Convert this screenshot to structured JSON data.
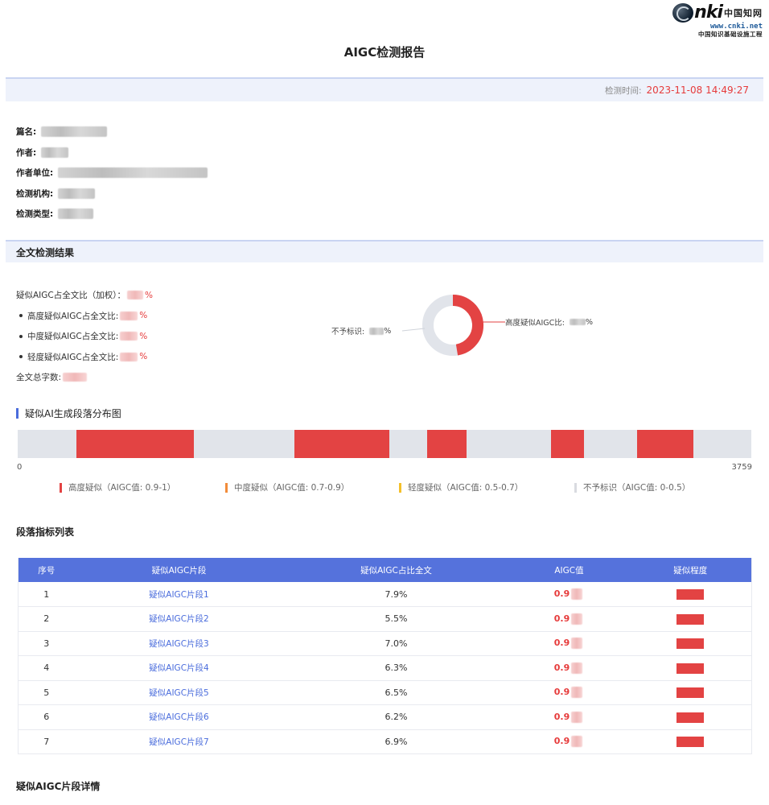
{
  "logo": {
    "mark": "nki",
    "chinese": "中国知网",
    "url": "www.cnki.net",
    "slogan": "中国知识基础设施工程"
  },
  "report": {
    "title": "AIGC检测报告",
    "time_label": "检测时间:",
    "time_value": "2023-11-08 14:49:27"
  },
  "meta": {
    "title_label": "篇名:",
    "author_label": "作者:",
    "unit_label": "作者单位:",
    "org_label": "检测机构:",
    "type_label": "检测类型:"
  },
  "full_result": {
    "section_title": "全文检测结果",
    "weighted_label": "疑似AIGC占全文比（加权）：",
    "high_label": "高度疑似AIGC占全文比:",
    "mid_label": "中度疑似AIGC占全文比:",
    "low_label": "轻度疑似AIGC占全文比:",
    "total_label": "全文总字数:",
    "pct_suffix": "%",
    "donut": {
      "high_label": "高度疑似AIGC比:",
      "none_label": "不予标识:",
      "high_color": "#e34343",
      "none_color": "#e1e4ea"
    }
  },
  "distribution": {
    "title": "疑似AI生成段落分布图",
    "axis_min": "0",
    "axis_max": "3759",
    "legend": [
      {
        "label": "高度疑似（AIGC值: 0.9-1）",
        "color": "#e34343"
      },
      {
        "label": "中度疑似（AIGC值: 0.7-0.9）",
        "color": "#f28c3a"
      },
      {
        "label": "轻度疑似（AIGC值: 0.5-0.7）",
        "color": "#f4c02a"
      },
      {
        "label": "不予标识（AIGC值: 0-0.5）",
        "color": "#d9dbe0"
      }
    ]
  },
  "paragraph_list": {
    "title": "段落指标列表",
    "headers": [
      "序号",
      "疑似AIGC片段",
      "疑似AIGC占比全文",
      "AIGC值",
      "疑似程度"
    ],
    "rows": [
      {
        "no": "1",
        "fragment": "疑似AIGC片段1",
        "ratio": "7.9%",
        "aigc": "0.9"
      },
      {
        "no": "2",
        "fragment": "疑似AIGC片段2",
        "ratio": "5.5%",
        "aigc": "0.9"
      },
      {
        "no": "3",
        "fragment": "疑似AIGC片段3",
        "ratio": "7.0%",
        "aigc": "0.9"
      },
      {
        "no": "4",
        "fragment": "疑似AIGC片段4",
        "ratio": "6.3%",
        "aigc": "0.9"
      },
      {
        "no": "5",
        "fragment": "疑似AIGC片段5",
        "ratio": "6.5%",
        "aigc": "0.9"
      },
      {
        "no": "6",
        "fragment": "疑似AIGC片段6",
        "ratio": "6.2%",
        "aigc": "0.9"
      },
      {
        "no": "7",
        "fragment": "疑似AIGC片段7",
        "ratio": "6.9%",
        "aigc": "0.9"
      }
    ]
  },
  "detail": {
    "title": "疑似AIGC片段详情"
  }
}
